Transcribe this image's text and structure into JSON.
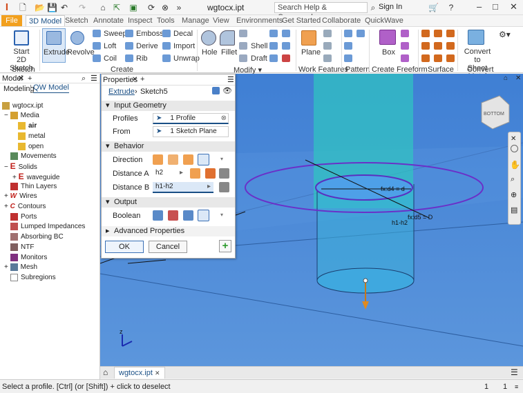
{
  "titlebar": {
    "title": "wgtocx.ipt",
    "search_placeholder": "Search Help & Commands...",
    "signin": "Sign In"
  },
  "tabs": [
    "File",
    "3D Model",
    "Sketch",
    "Annotate",
    "Inspect",
    "Tools",
    "Manage",
    "View",
    "Environments",
    "Get Started",
    "Collaborate",
    "QuickWave"
  ],
  "ribbon": {
    "start_sketch": "Start\n2D Sketch",
    "extrude": "Extrude",
    "revolve": "Revolve",
    "sweep": "Sweep",
    "emboss": "Emboss",
    "decal": "Decal",
    "loft": "Loft",
    "derive": "Derive",
    "import": "Import",
    "coil": "Coil",
    "rib": "Rib",
    "unwrap": "Unwrap",
    "hole": "Hole",
    "fillet": "Fillet",
    "shell": "Shell",
    "draft": "Draft",
    "plane": "Plane",
    "box": "Box",
    "convert": "Convert to\nSheet Metal",
    "groups": {
      "sketch": "Sketch",
      "create": "Create",
      "modify": "Modify ▾",
      "work_features": "Work Features",
      "pattern": "Pattern",
      "create_freeform": "Create Freeform",
      "surface": "Surface",
      "convert": "Convert"
    }
  },
  "model_panel": {
    "title": "Model",
    "tab_modeling": "Modeling",
    "tab_qw": "QW Model",
    "root": "wgtocx.ipt",
    "items": [
      "Media",
      "air",
      "metal",
      "open",
      "Movements",
      "Solids",
      "waveguide",
      "Thin Layers",
      "Wires",
      "Contours",
      "Ports",
      "Lumped Impedances",
      "Absorbing BC",
      "NTF",
      "Monitors",
      "Mesh",
      "Subregions"
    ]
  },
  "properties": {
    "title": "Properties",
    "breadcrumb_extrude": "Extrude",
    "breadcrumb_sketch": "Sketch5",
    "input_geometry": "Input Geometry",
    "profiles_label": "Profiles",
    "profiles_value": "1 Profile",
    "from_label": "From",
    "from_value": "1 Sketch Plane",
    "behavior": "Behavior",
    "direction_label": "Direction",
    "distance_a_label": "Distance A",
    "distance_a_value": "h2",
    "distance_b_label": "Distance B",
    "distance_b_value": "h1-h2",
    "output": "Output",
    "boolean_label": "Boolean",
    "advanced": "Advanced Properties",
    "ok": "OK",
    "cancel": "Cancel"
  },
  "viewport": {
    "dim_d4": "fx:d4 = d",
    "dim_d5": "fx:d5 = D",
    "dim_h": "h1-h2",
    "viewcube": "BOTTOM"
  },
  "doctab": "wgtocx.ipt",
  "status": {
    "message": "Select a profile. [Ctrl] (or [Shift]) + click to deselect",
    "count1": "1",
    "count2": "1"
  },
  "colors": {
    "accent": "#1a4f85",
    "viewport": "#4d8ad8",
    "file_tab": "#f2a01e"
  }
}
